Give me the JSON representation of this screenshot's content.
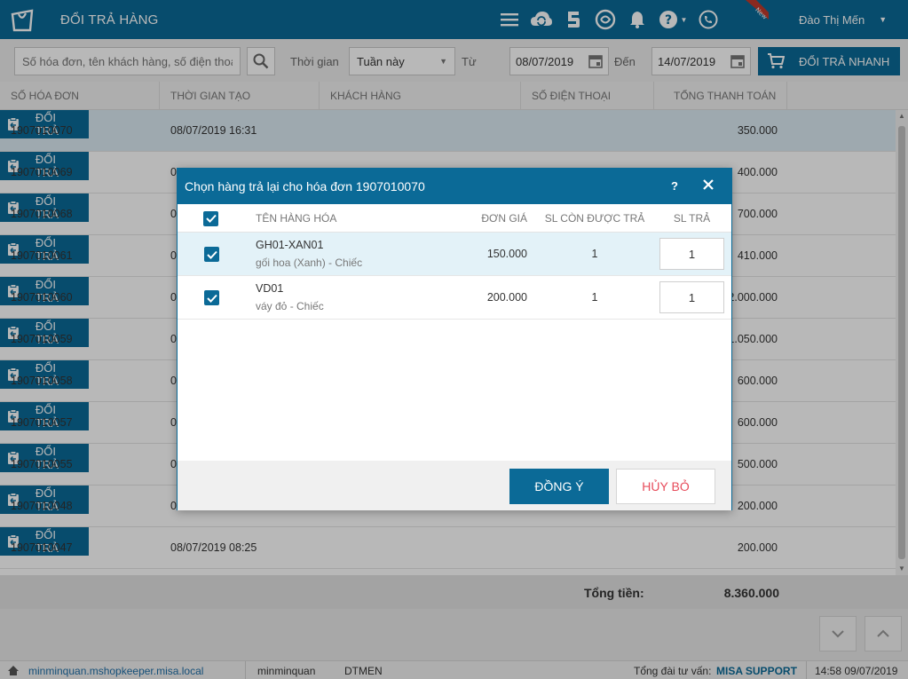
{
  "app": {
    "title": "ĐỔI TRẢ HÀNG",
    "user": "Đào Thị Mến",
    "new_badge": "New"
  },
  "colors": {
    "primary": "#0b6a97",
    "cancel": "#e74c5b",
    "selected_row": "#dcebf3",
    "badge": "#c0392b"
  },
  "icons": [
    "shop-logo-icon",
    "menu-icon",
    "cloud-sync-icon",
    "coin-icon",
    "refresh-swirl-icon",
    "bell-icon",
    "help-icon",
    "phone-icon",
    "search-icon",
    "calendar-icon",
    "cart-icon",
    "exchange-icon",
    "home-icon"
  ],
  "filter": {
    "search_placeholder": "Số hóa đơn, tên khách hàng, số điện thoại",
    "time_label": "Thời gian",
    "period": "Tuần này",
    "from_label": "Từ",
    "from_date": "08/07/2019",
    "to_label": "Đến",
    "to_date": "14/07/2019",
    "quick_button": "ĐỔI TRẢ NHANH"
  },
  "table": {
    "headers": [
      "SỐ HÓA ĐƠN",
      "THỜI GIAN TẠO",
      "KHÁCH HÀNG",
      "SỐ ĐIỆN THOẠI",
      "TỔNG THANH TOÁN"
    ],
    "action_label": "ĐỔI TRẢ",
    "rows": [
      {
        "no": "1907010070",
        "time": "08/07/2019 16:31",
        "total": "350.000"
      },
      {
        "no": "1907010069",
        "time": "0",
        "total": "400.000"
      },
      {
        "no": "1907010068",
        "time": "0",
        "total": "700.000"
      },
      {
        "no": "1907010061",
        "time": "0",
        "total": "410.000"
      },
      {
        "no": "1907010060",
        "time": "0",
        "total": "2.000.000"
      },
      {
        "no": "1907010059",
        "time": "0",
        "total": "1.050.000"
      },
      {
        "no": "1907010058",
        "time": "0",
        "total": "600.000"
      },
      {
        "no": "1907010057",
        "time": "0",
        "total": "600.000"
      },
      {
        "no": "1907010055",
        "time": "0",
        "total": "500.000"
      },
      {
        "no": "1907010048",
        "time": "0",
        "total": "200.000"
      },
      {
        "no": "1907010047",
        "time": "08/07/2019 08:25",
        "total": "200.000"
      }
    ],
    "total_label": "Tổng tiền:",
    "total_value": "8.360.000"
  },
  "modal": {
    "title": "Chọn hàng trả lại cho hóa đơn 1907010070",
    "help": "?",
    "headers": [
      "TÊN HÀNG HÓA",
      "ĐƠN GIÁ",
      "SL CÒN ĐƯỢC TRẢ",
      "SL TRẢ"
    ],
    "items": [
      {
        "code": "GH01-XAN01",
        "desc": "gối hoa (Xanh) - Chiếc",
        "price": "150.000",
        "remaining": "1",
        "qty": "1",
        "checked": true
      },
      {
        "code": "VD01",
        "desc": "váy đỏ - Chiếc",
        "price": "200.000",
        "remaining": "1",
        "qty": "1",
        "checked": true
      }
    ],
    "ok_label": "ĐỒNG Ý",
    "cancel_label": "HỦY BỎ"
  },
  "status": {
    "domain": "minminquan.mshopkeeper.misa.local",
    "account": "minminquan",
    "branch": "DTMEN",
    "support_label": "Tổng đài tư vấn:",
    "support_name": "MISA SUPPORT",
    "datetime": "14:58 09/07/2019"
  }
}
